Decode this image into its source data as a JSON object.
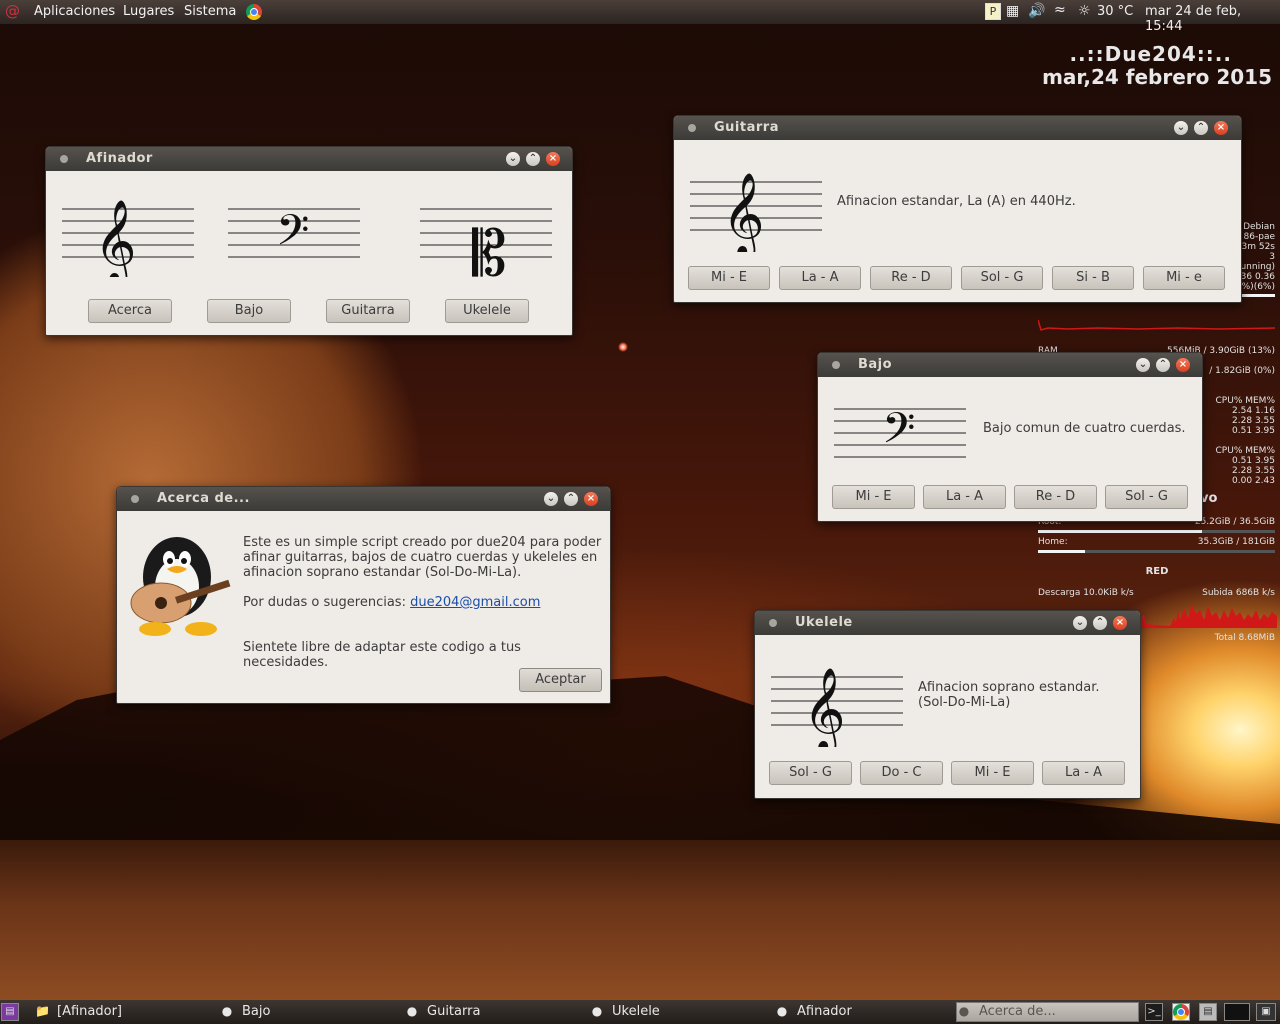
{
  "top_panel": {
    "menus": [
      "Aplicaciones",
      "Lugares",
      "Sistema"
    ],
    "temperature": "30 °C",
    "datetime": "mar 24 de feb, 15:44",
    "tray_p": "P"
  },
  "desktop": {
    "conky_title": "..::Due204::..",
    "conky_date": "mar,24 febrero 2015",
    "sys_lines": [
      "Debian",
      "86-pae",
      "3m 52s",
      "3",
      "unning)",
      "36 0.36",
      "%)(6%)"
    ],
    "ram_label": "RAM",
    "ram_value": "556MiB / 3.90GiB (13%)",
    "swap_value": "/ 1.82GiB (0%)",
    "proc_header": "CPU% MEM%",
    "proc_rows_1": [
      "2.54  1.16",
      "2.28  3.55",
      "0.51  3.95"
    ],
    "proc_rows_2": [
      "0.51  3.95",
      "2.28  3.55",
      "0.00  2.43"
    ],
    "vo_label": "vo",
    "root_label": "Root:",
    "root_value": "25.2GiB / 36.5GiB",
    "root_fraction": 0.69,
    "home_label": "Home:",
    "home_value": "35.3GiB / 181GiB",
    "home_fraction": 0.2,
    "net_title": "RED",
    "download": "Descarga 10.0KiB k/s",
    "upload": "Subida 686B   k/s",
    "total": "Total 8.68MiB"
  },
  "afinador": {
    "title": "Afinador",
    "buttons": [
      "Acerca",
      "Bajo",
      "Guitarra",
      "Ukelele"
    ]
  },
  "guitarra": {
    "title": "Guitarra",
    "description": "Afinacion estandar, La (A) en 440Hz.",
    "buttons": [
      "Mi - E",
      "La - A",
      "Re - D",
      "Sol - G",
      "Si - B",
      "Mi - e"
    ]
  },
  "bajo": {
    "title": "Bajo",
    "description": "Bajo comun de cuatro cuerdas.",
    "buttons": [
      "Mi - E",
      "La - A",
      "Re - D",
      "Sol - G"
    ]
  },
  "acerca": {
    "title": "Acerca de...",
    "paragraph1_line1": "Este es un simple script creado por due204 para poder",
    "paragraph1_line2": "afinar guitarras, bajos de cuatro cuerdas y ukeleles en",
    "paragraph1_line3": "afinacion soprano estandar (Sol-Do-Mi-La).",
    "contact_prefix": "Por dudas o sugerencias: ",
    "contact_email": "due204@gmail.com",
    "paragraph3": "Sientete libre de adaptar este codigo a tus necesidades.",
    "accept_button": "Aceptar"
  },
  "ukelele": {
    "title": "Ukelele",
    "description_line1": "Afinacion soprano estandar.",
    "description_line2": "(Sol-Do-Mi-La)",
    "buttons": [
      "Sol - G",
      "Do - C",
      "Mi - E",
      "La - A"
    ]
  },
  "taskbar": {
    "tasks": [
      "[Afinador]",
      "Bajo",
      "Guitarra",
      "Ukelele",
      "Afinador",
      "Acerca de..."
    ]
  },
  "colors": {
    "titlebar": "#3c3b37",
    "window_bg": "#efebe7",
    "close_button": "#d9401f",
    "link": "#1a4fa8"
  }
}
